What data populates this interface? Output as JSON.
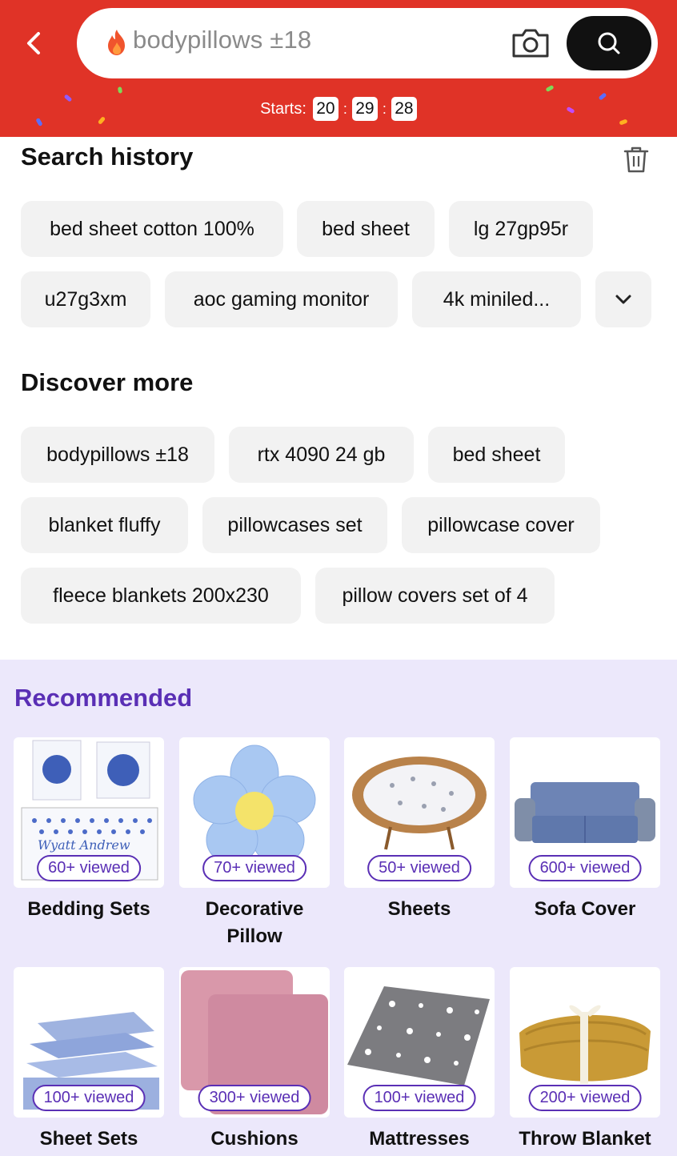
{
  "header": {
    "search_text": "bodypillows ±18",
    "countdown_label": "Starts:",
    "countdown": [
      "20",
      "29",
      "28"
    ],
    "brand_color": "#e03327"
  },
  "search_history": {
    "title": "Search history",
    "items": [
      "bed sheet cotton 100%",
      "bed sheet",
      "lg 27gp95r",
      "u27g3xm",
      "aoc gaming monitor",
      "4k miniled..."
    ]
  },
  "discover_more": {
    "title": "Discover more",
    "items": [
      "bodypillows ±18",
      "rtx 4090 24 gb",
      "bed sheet",
      "blanket fluffy",
      "pillowcases set",
      "pillowcase cover",
      "fleece blankets 200x230",
      "pillow covers set of 4"
    ]
  },
  "recommended": {
    "title": "Recommended",
    "accent_color": "#5a2fb5",
    "items": [
      {
        "label": "Bedding Sets",
        "viewed": "60+ viewed"
      },
      {
        "label": "Decorative Pillow",
        "viewed": "70+ viewed"
      },
      {
        "label": "Sheets",
        "viewed": "50+ viewed"
      },
      {
        "label": "Sofa Cover",
        "viewed": "600+ viewed"
      },
      {
        "label": "Sheet Sets",
        "viewed": "100+ viewed"
      },
      {
        "label": "Cushions",
        "viewed": "300+ viewed"
      },
      {
        "label": "Mattresses",
        "viewed": "100+ viewed"
      },
      {
        "label": "Throw Blanket",
        "viewed": "200+ viewed"
      }
    ]
  },
  "icons": [
    "back-arrow-icon",
    "fire-icon",
    "camera-icon",
    "search-icon",
    "trash-icon",
    "chevron-down-icon"
  ]
}
